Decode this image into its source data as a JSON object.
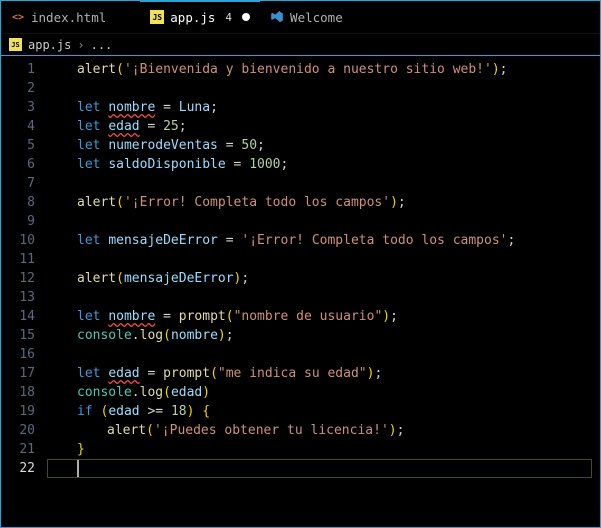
{
  "tabs": [
    {
      "icon": "html5-icon",
      "label": "index.html",
      "active": false,
      "dirty": false,
      "badge": ""
    },
    {
      "icon": "js-icon",
      "label": "app.js",
      "active": true,
      "dirty": true,
      "badge": "4"
    },
    {
      "icon": "vscode-icon",
      "label": "Welcome",
      "active": false,
      "dirty": false,
      "badge": ""
    }
  ],
  "breadcrumb": {
    "icon": "js-icon",
    "file": "app.js",
    "sep": "›",
    "trail": "..."
  },
  "editor": {
    "cursor_line": 22,
    "lines": [
      {
        "n": 1,
        "tokens": [
          [
            "fn",
            "alert"
          ],
          [
            "p",
            "("
          ],
          [
            "s",
            "'¡Bienvenida y bienvenido a nuestro sitio web!'"
          ],
          [
            "p",
            ")"
          ],
          [
            "op",
            ";"
          ]
        ]
      },
      {
        "n": 2,
        "tokens": []
      },
      {
        "n": 3,
        "tokens": [
          [
            "k",
            "let "
          ],
          [
            "v",
            "nombre",
            true
          ],
          [
            "op",
            " = "
          ],
          [
            "v",
            "Luna"
          ],
          [
            "op",
            ";"
          ]
        ]
      },
      {
        "n": 4,
        "tokens": [
          [
            "k",
            "let "
          ],
          [
            "v",
            "edad",
            true
          ],
          [
            "op",
            " = "
          ],
          [
            "n",
            "25"
          ],
          [
            "op",
            ";"
          ]
        ]
      },
      {
        "n": 5,
        "tokens": [
          [
            "k",
            "let "
          ],
          [
            "v",
            "numerodeVentas"
          ],
          [
            "op",
            " = "
          ],
          [
            "n",
            "50"
          ],
          [
            "op",
            ";"
          ]
        ]
      },
      {
        "n": 6,
        "tokens": [
          [
            "k",
            "let "
          ],
          [
            "v",
            "saldoDisponible"
          ],
          [
            "op",
            " = "
          ],
          [
            "n",
            "1000"
          ],
          [
            "op",
            ";"
          ]
        ]
      },
      {
        "n": 7,
        "tokens": []
      },
      {
        "n": 8,
        "tokens": [
          [
            "fn",
            "alert"
          ],
          [
            "p",
            "("
          ],
          [
            "s",
            "'¡Error! Completa todo los campos'"
          ],
          [
            "p",
            ")"
          ],
          [
            "op",
            ";"
          ]
        ]
      },
      {
        "n": 9,
        "tokens": []
      },
      {
        "n": 10,
        "tokens": [
          [
            "k",
            "let "
          ],
          [
            "v",
            "mensajeDeError"
          ],
          [
            "op",
            " = "
          ],
          [
            "s",
            "'¡Error! Completa todo los campos'"
          ],
          [
            "op",
            ";"
          ]
        ]
      },
      {
        "n": 11,
        "tokens": []
      },
      {
        "n": 12,
        "tokens": [
          [
            "fn",
            "alert"
          ],
          [
            "p",
            "("
          ],
          [
            "v",
            "mensajeDeError"
          ],
          [
            "p",
            ")"
          ],
          [
            "op",
            ";"
          ]
        ]
      },
      {
        "n": 13,
        "tokens": []
      },
      {
        "n": 14,
        "tokens": [
          [
            "k",
            "let "
          ],
          [
            "v",
            "nombre",
            true
          ],
          [
            "op",
            " = "
          ],
          [
            "fn",
            "prompt"
          ],
          [
            "p",
            "("
          ],
          [
            "s",
            "\"nombre de usuario\""
          ],
          [
            "p",
            ")"
          ],
          [
            "op",
            ";"
          ]
        ]
      },
      {
        "n": 15,
        "tokens": [
          [
            "obj",
            "console"
          ],
          [
            "op",
            "."
          ],
          [
            "fn",
            "log"
          ],
          [
            "p",
            "("
          ],
          [
            "v",
            "nombre"
          ],
          [
            "p",
            ")"
          ],
          [
            "op",
            ";"
          ]
        ]
      },
      {
        "n": 16,
        "tokens": []
      },
      {
        "n": 17,
        "tokens": [
          [
            "k",
            "let "
          ],
          [
            "v",
            "edad",
            true
          ],
          [
            "op",
            " = "
          ],
          [
            "fn",
            "prompt"
          ],
          [
            "p",
            "("
          ],
          [
            "s",
            "\"me indica su edad\""
          ],
          [
            "p",
            ")"
          ],
          [
            "op",
            ";"
          ]
        ]
      },
      {
        "n": 18,
        "tokens": [
          [
            "obj",
            "console"
          ],
          [
            "op",
            "."
          ],
          [
            "fn",
            "log"
          ],
          [
            "p",
            "("
          ],
          [
            "v",
            "edad"
          ],
          [
            "p",
            ")"
          ]
        ]
      },
      {
        "n": 19,
        "tokens": [
          [
            "k",
            "if"
          ],
          [
            "op",
            " "
          ],
          [
            "p",
            "("
          ],
          [
            "v",
            "edad"
          ],
          [
            "op",
            " >= "
          ],
          [
            "n",
            "18"
          ],
          [
            "p",
            ")"
          ],
          [
            "op",
            " "
          ],
          [
            "p",
            "{"
          ]
        ]
      },
      {
        "n": 20,
        "indent": 2,
        "tokens": [
          [
            "fn",
            "alert"
          ],
          [
            "p",
            "("
          ],
          [
            "s",
            "'¡Puedes obtener tu licencia!'"
          ],
          [
            "p",
            ")"
          ],
          [
            "op",
            ";"
          ]
        ]
      },
      {
        "n": 21,
        "tokens": [
          [
            "p",
            "}"
          ]
        ]
      },
      {
        "n": 22,
        "tokens": []
      }
    ]
  }
}
